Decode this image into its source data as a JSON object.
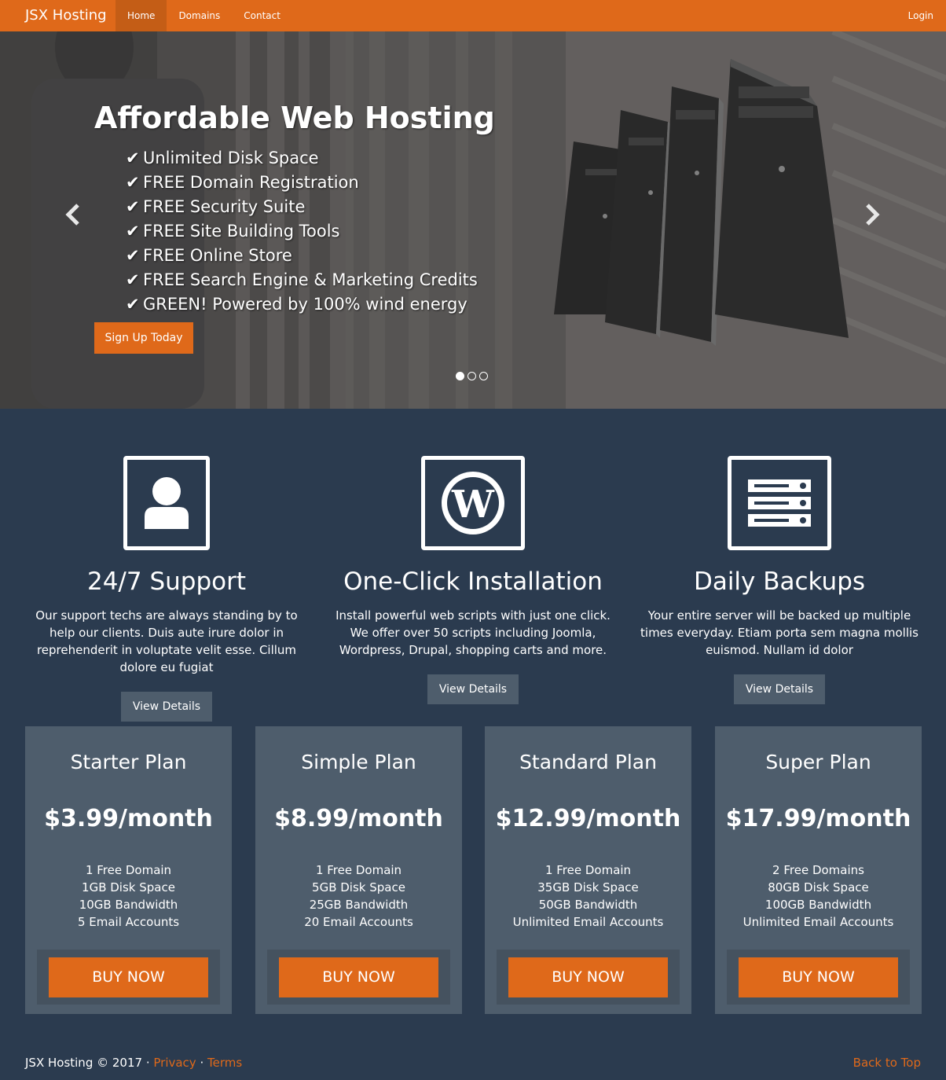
{
  "navbar": {
    "brand": "JSX Hosting",
    "items": [
      {
        "label": "Home",
        "active": true
      },
      {
        "label": "Domains",
        "active": false
      },
      {
        "label": "Contact",
        "active": false
      }
    ],
    "login_label": "Login"
  },
  "hero": {
    "title": "Affordable Web Hosting",
    "check_glyph": "✔",
    "features": [
      "Unlimited Disk Space",
      "FREE Domain Registration",
      "FREE Security Suite",
      "FREE Site Building Tools",
      "FREE Online Store",
      "FREE Search Engine & Marketing Credits",
      "GREEN! Powered by 100% wind energy"
    ],
    "cta_label": "Sign Up Today",
    "prev_icon": "chevron-left-icon",
    "next_icon": "chevron-right-icon",
    "slide_count": 3,
    "active_slide": 1
  },
  "features": [
    {
      "icon": "user-icon",
      "title": "24/7 Support",
      "text": "Our support techs are always standing by to help our clients. Duis aute irure dolor in reprehenderit in voluptate velit esse. Cillum dolore eu fugiat",
      "button": "View Details"
    },
    {
      "icon": "wordpress-icon",
      "title": "One-Click Installation",
      "text": "Install powerful web scripts with just one click. We offer over 50 scripts including Joomla, Wordpress, Drupal, shopping carts and more.",
      "button": "View Details"
    },
    {
      "icon": "server-icon",
      "title": "Daily Backups",
      "text": "Your entire server will be backed up multiple times everyday. Etiam porta sem magna mollis euismod. Nullam id dolor",
      "button": "View Details"
    }
  ],
  "plans": [
    {
      "name": "Starter Plan",
      "price": "$3.99/month",
      "items": [
        "1 Free Domain",
        "1GB Disk Space",
        "10GB Bandwidth",
        "5 Email Accounts"
      ],
      "button": "BUY NOW"
    },
    {
      "name": "Simple Plan",
      "price": "$8.99/month",
      "items": [
        "1 Free Domain",
        "5GB Disk Space",
        "25GB Bandwidth",
        "20 Email Accounts"
      ],
      "button": "BUY NOW"
    },
    {
      "name": "Standard Plan",
      "price": "$12.99/month",
      "items": [
        "1 Free Domain",
        "35GB Disk Space",
        "50GB Bandwidth",
        "Unlimited Email Accounts"
      ],
      "button": "BUY NOW"
    },
    {
      "name": "Super Plan",
      "price": "$17.99/month",
      "items": [
        "2 Free Domains",
        "80GB Disk Space",
        "100GB Bandwidth",
        "Unlimited Email Accounts"
      ],
      "button": "BUY NOW"
    }
  ],
  "footer": {
    "copyright": "JSX Hosting © 2017 ·",
    "privacy": "Privacy",
    "separator": "·",
    "terms": "Terms",
    "back_to_top": "Back to Top"
  },
  "colors": {
    "accent": "#df691a",
    "background": "#2b3b4f",
    "panel": "#4e5d6c"
  }
}
